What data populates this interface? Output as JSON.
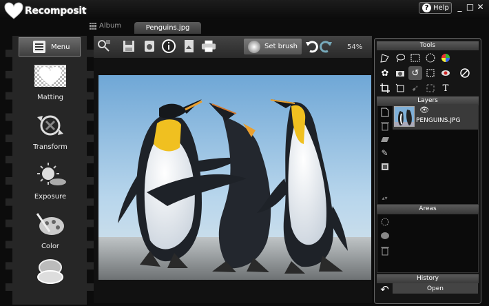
{
  "app": {
    "name": "Recomposit"
  },
  "titlebar": {
    "help_label": "Help",
    "help_icon": "?",
    "min": "_",
    "max": "□",
    "close": "✕"
  },
  "tabs": {
    "album": "Album",
    "active_file": "Penguins.jpg"
  },
  "sidebar": {
    "menu_label": "Menu",
    "items": [
      {
        "label": "Matting"
      },
      {
        "label": "Transform"
      },
      {
        "label": "Exposure"
      },
      {
        "label": "Color"
      }
    ]
  },
  "toolbar": {
    "set_brush_label": "Set brush",
    "zoom": "54%"
  },
  "panel": {
    "tools_title": "Tools",
    "layers_title": "Layers",
    "layer_name": "PENGUINS.JPG",
    "areas_title": "Areas",
    "history_title": "History",
    "history_item": "Open"
  },
  "colors": {
    "accent": "#f0c020",
    "sky": "#a9cde6",
    "background": "#0c0c0c"
  }
}
